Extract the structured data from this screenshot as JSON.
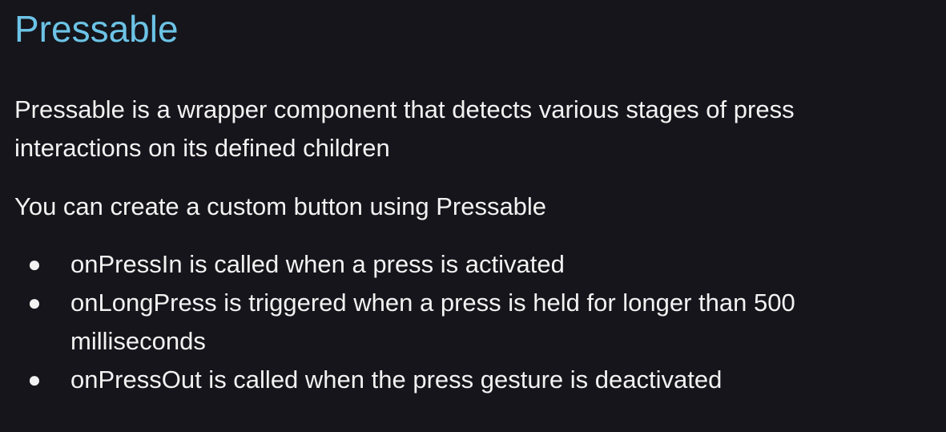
{
  "slide": {
    "title": "Pressable",
    "paragraphs": [
      "Pressable is a wrapper component that detects various stages of press interactions on its defined children",
      "You can create a custom button using Pressable"
    ],
    "bullet_symbol": "●",
    "bullets": [
      "onPressIn is called when a press is activated",
      "onLongPress is triggered when a press is held for longer than 500 milliseconds",
      "onPressOut is called when the press gesture is deactivated"
    ]
  },
  "colors": {
    "background": "#15151b",
    "title": "#6cc3e6",
    "text": "#f2f2f2"
  }
}
